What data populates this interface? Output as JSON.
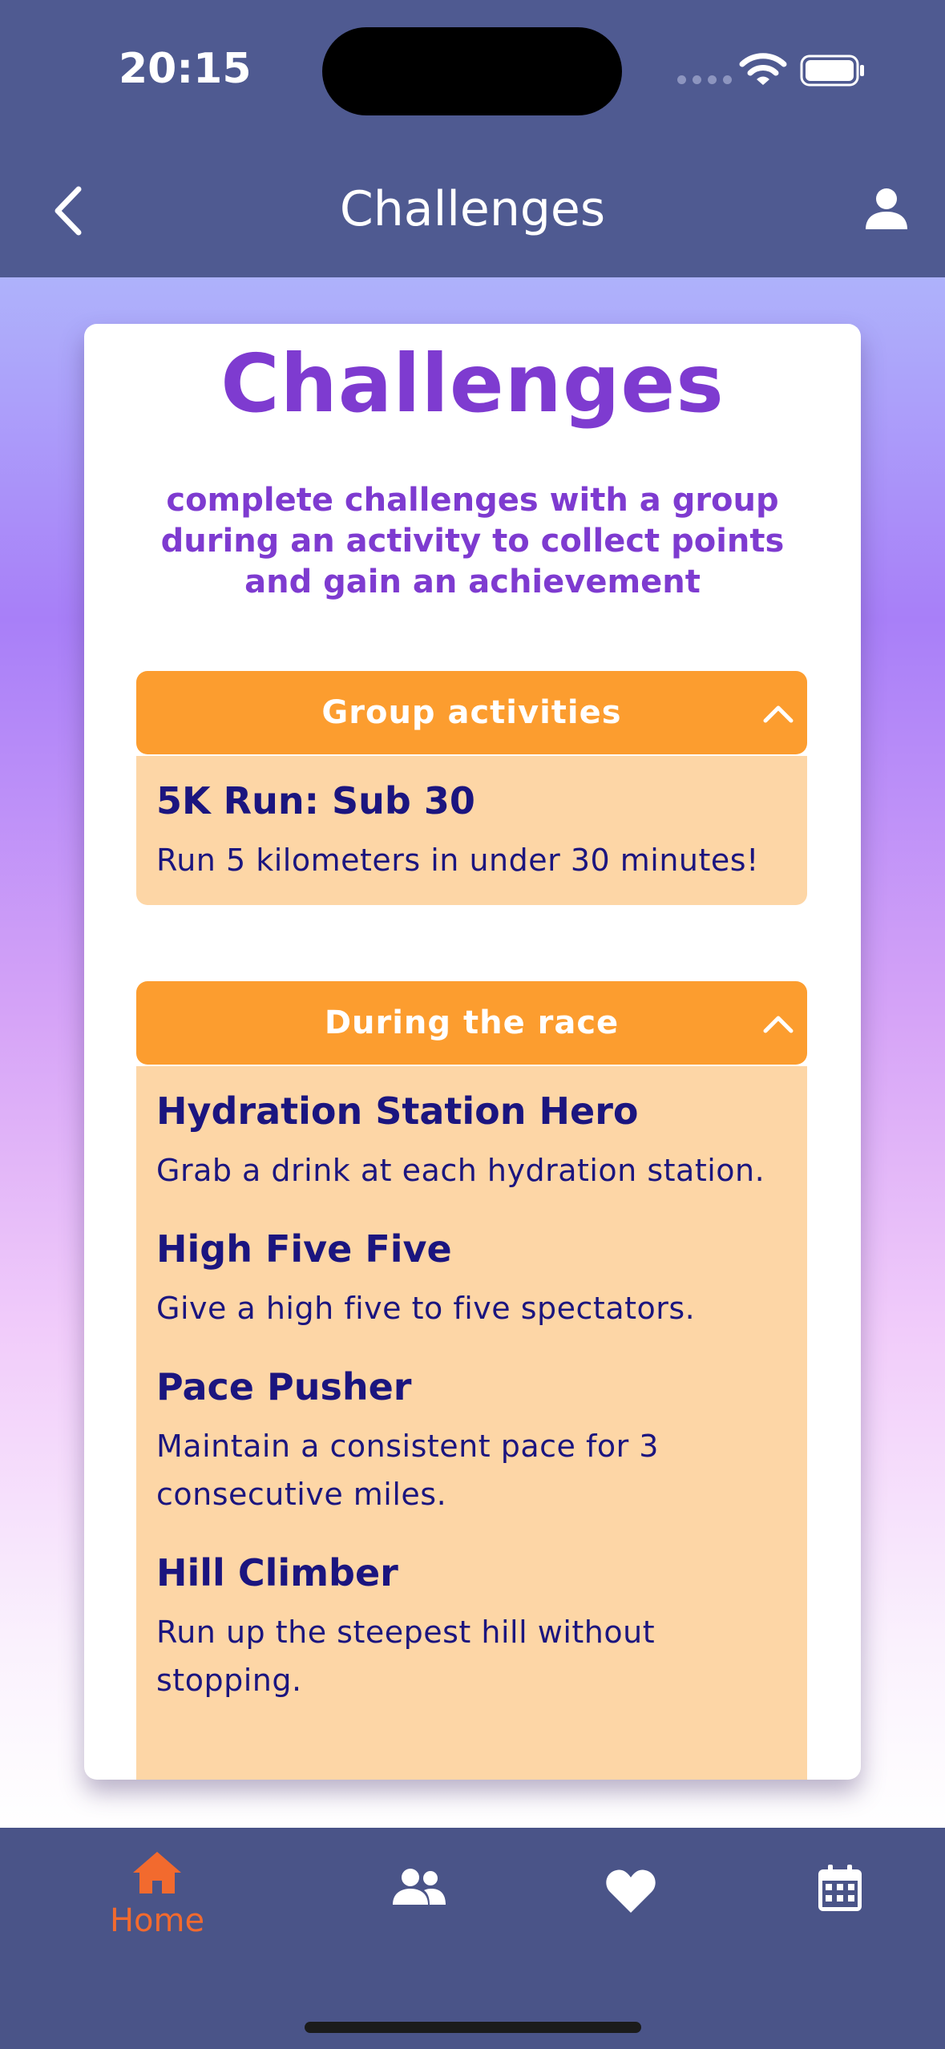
{
  "status_bar": {
    "time": "20:15"
  },
  "header": {
    "title": "Challenges"
  },
  "card": {
    "title": "Challenges",
    "subtitle": "complete challenges with a group during an activity to collect points and gain an achievement"
  },
  "sections": [
    {
      "label": "Group activities",
      "items": [
        {
          "title": "5K Run: Sub 30",
          "description": "Run 5 kilometers in under 30 minutes!"
        }
      ]
    },
    {
      "label": "During the race",
      "items": [
        {
          "title": "Hydration Station Hero",
          "description": "Grab a drink at each hydration station."
        },
        {
          "title": "High Five Five",
          "description": "Give a high five to five spectators."
        },
        {
          "title": "Pace Pusher",
          "description": "Maintain a consistent pace for 3 consecutive miles."
        },
        {
          "title": "Hill Climber",
          "description": "Run up the steepest hill without stopping."
        }
      ]
    }
  ],
  "tabbar": {
    "home_label": "Home",
    "active_color": "#f26a2e"
  },
  "colors": {
    "header_bg": "#4f5a91",
    "accent_purple": "#7e3bd0",
    "section_header": "#fc9d2f",
    "section_body": "#fdd6a6",
    "item_text": "#1b157f"
  }
}
